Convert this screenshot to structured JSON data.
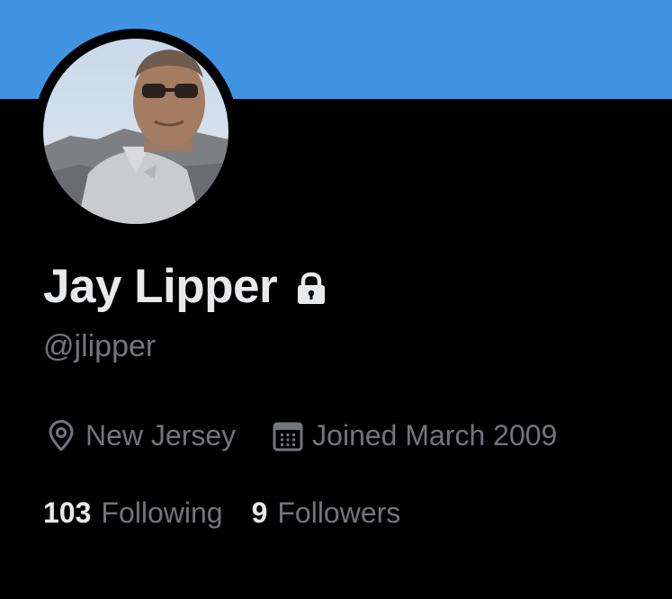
{
  "profile": {
    "display_name": "Jay Lipper",
    "handle": "@jlipper",
    "protected_icon": "lock-icon",
    "location": "New Jersey",
    "location_icon": "location-pin-icon",
    "joined": "Joined March 2009",
    "joined_icon": "calendar-icon",
    "following_count": "103",
    "following_label": "Following",
    "followers_count": "9",
    "followers_label": "Followers"
  },
  "colors": {
    "banner": "#4194e2",
    "background": "#000000",
    "primary_text": "#e7e9ea",
    "secondary_text": "#71767b"
  }
}
